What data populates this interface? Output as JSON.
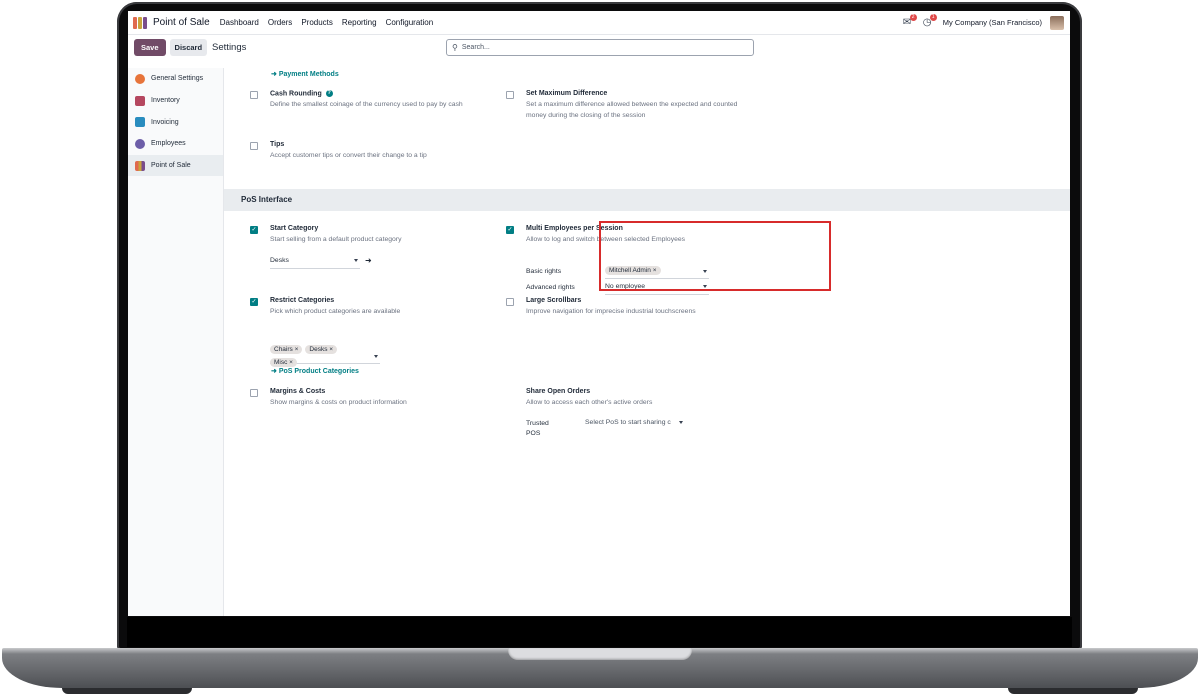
{
  "nav": {
    "app_name": "Point of Sale",
    "menu": [
      "Dashboard",
      "Orders",
      "Products",
      "Reporting",
      "Configuration"
    ],
    "chat_count": "2",
    "activity_count": "1",
    "company": "My Company (San Francisco)"
  },
  "control": {
    "save_label": "Save",
    "discard_label": "Discard",
    "breadcrumb": "Settings",
    "search_placeholder": "Search..."
  },
  "sidebar": {
    "items": [
      {
        "label": "General Settings",
        "color": "#e7743a"
      },
      {
        "label": "Inventory",
        "color": "#b5475f"
      },
      {
        "label": "Invoicing",
        "color": "#2a8dbf"
      },
      {
        "label": "Employees",
        "color": "#6d5ea8"
      },
      {
        "label": "Point of Sale",
        "color": "#a5495a"
      }
    ]
  },
  "content": {
    "payment_methods_link": "Payment Methods",
    "cash_rounding": {
      "title": "Cash Rounding",
      "desc": "Define the smallest coinage of the currency used to pay by cash",
      "checked": false
    },
    "max_difference": {
      "title": "Set Maximum Difference",
      "desc": "Set a maximum difference allowed between the expected and counted money during the closing of the session",
      "checked": false
    },
    "tips": {
      "title": "Tips",
      "desc": "Accept customer tips or convert their change to a tip",
      "checked": false
    },
    "section_title": "PoS Interface",
    "start_category": {
      "title": "Start Category",
      "desc": "Start selling from a default product category",
      "value": "Desks",
      "checked": true
    },
    "multi_employees": {
      "title": "Multi Employees per Session",
      "desc": "Allow to log and switch between selected Employees",
      "checked": true,
      "basic_rights_label": "Basic rights",
      "basic_rights_tag": "Mitchell Admin",
      "advanced_rights_label": "Advanced rights",
      "advanced_rights_value": "No employee"
    },
    "restrict_categories": {
      "title": "Restrict Categories",
      "desc": "Pick which product categories are available",
      "checked": true,
      "tags": [
        "Chairs",
        "Desks",
        "Misc"
      ]
    },
    "large_scrollbars": {
      "title": "Large Scrollbars",
      "desc": "Improve navigation for imprecise industrial touchscreens",
      "checked": false
    },
    "pos_product_categories_link": "PoS Product Categories",
    "margins": {
      "title": "Margins & Costs",
      "desc": "Show margins & costs on product information",
      "checked": false
    },
    "share_orders": {
      "title": "Share Open Orders",
      "desc": "Allow to access each other's active orders",
      "trusted_label": "Trusted POS",
      "placeholder": "Select PoS to start sharing c"
    }
  }
}
